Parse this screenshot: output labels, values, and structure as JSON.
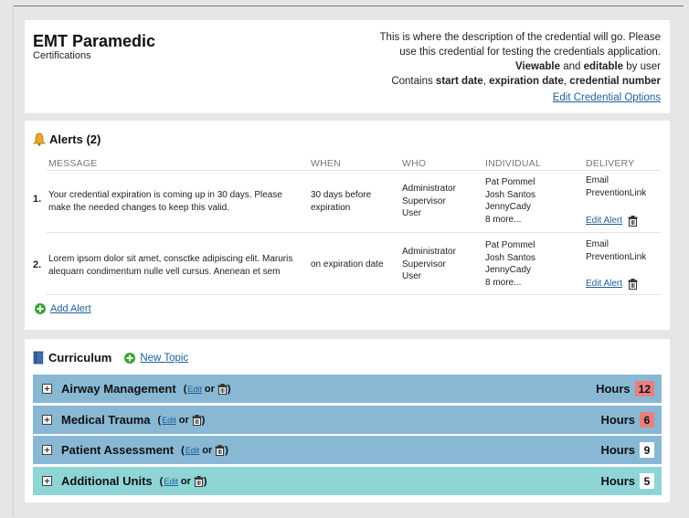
{
  "credential": {
    "title": "EMT Paramedic",
    "category": "Certifications",
    "description_line1": "This is where the description of the credential will go. Please",
    "description_line2": "use this credential for testing the credentials application.",
    "viewable": "Viewable",
    "and": "and",
    "editable": "editable",
    "by_user": "by user",
    "contains": "Contains",
    "start_date": "start date",
    "expiration_date": "expiration date",
    "credential_number": "credential number",
    "edit_options_link": "Edit Credential Options"
  },
  "alerts": {
    "heading": "Alerts (2)",
    "columns": {
      "message": "MESSAGE",
      "when": "WHEN",
      "who": "WHO",
      "individual": "INDIVIDUAL",
      "delivery": "DELIVERY"
    },
    "rows": [
      {
        "num": "1.",
        "message_l1": "Your credential expiration is coming up in 30 days. Please",
        "message_l2": "make the needed changes to keep this valid.",
        "when_l1": "30 days before",
        "when_l2": "expiration",
        "who": [
          "Administrator",
          "Supervisor",
          "User"
        ],
        "individual": [
          "Pat Pommel",
          "Josh Santos",
          "JennyCady",
          "8 more..."
        ],
        "delivery": [
          "Email",
          "PreventionLink"
        ],
        "edit_label": "Edit Alert"
      },
      {
        "num": "2.",
        "message_l1": "Lorem ipsom dolor sit amet, consctke adipiscing elit. Maruris",
        "message_l2": "alequarn condimentum nulle vell cursus. Anenean et sem",
        "when_l1": "on expiration date",
        "when_l2": "",
        "who": [
          "Administrator",
          "Supervisor",
          "User"
        ],
        "individual": [
          "Pat Pommel",
          "Josh Santos",
          "JennyCady",
          "8 more..."
        ],
        "delivery": [
          "Email",
          "PreventionLink"
        ],
        "edit_label": "Edit Alert"
      }
    ],
    "add_label": "Add Alert"
  },
  "curriculum": {
    "heading": "Curriculum",
    "new_topic_label": "New Topic",
    "hours_label": "Hours",
    "edit_label": "Edit",
    "or_label": "or",
    "topics": [
      {
        "name": "Airway Management",
        "hours": "12",
        "hours_color": "#e87f7f",
        "row_color": "#88b8d4"
      },
      {
        "name": "Medical Trauma",
        "hours": "6",
        "hours_color": "#e87f7f",
        "row_color": "#88b8d4"
      },
      {
        "name": "Patient Assessment",
        "hours": "9",
        "hours_color": "#ffffff",
        "row_color": "#88b8d4"
      },
      {
        "name": "Additional Units",
        "hours": "5",
        "hours_color": "#ffffff",
        "row_color": "#8fd5d6"
      }
    ]
  },
  "icons": {
    "alerts": "bell-icon",
    "curriculum": "book-icon",
    "add": "plus-circle-icon",
    "delete": "trash-icon",
    "expand": "expand-icon"
  }
}
